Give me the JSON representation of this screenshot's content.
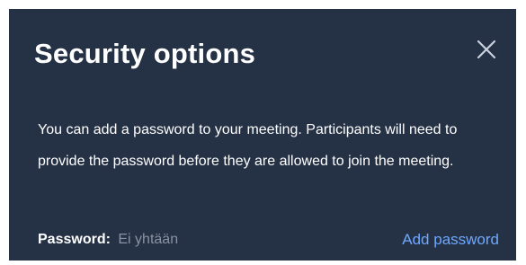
{
  "dialog": {
    "title": "Security options",
    "close_icon": "close-icon",
    "description": "You can add a password to your meeting. Participants will need to provide the password before they are allowed to join the meeting.",
    "password": {
      "label": "Password:",
      "value": "Ei yhtään",
      "add_link": "Add password"
    }
  },
  "colors": {
    "background": "#253145",
    "text": "#ffffff",
    "muted": "#8a93a3",
    "link": "#6fa8ff"
  }
}
